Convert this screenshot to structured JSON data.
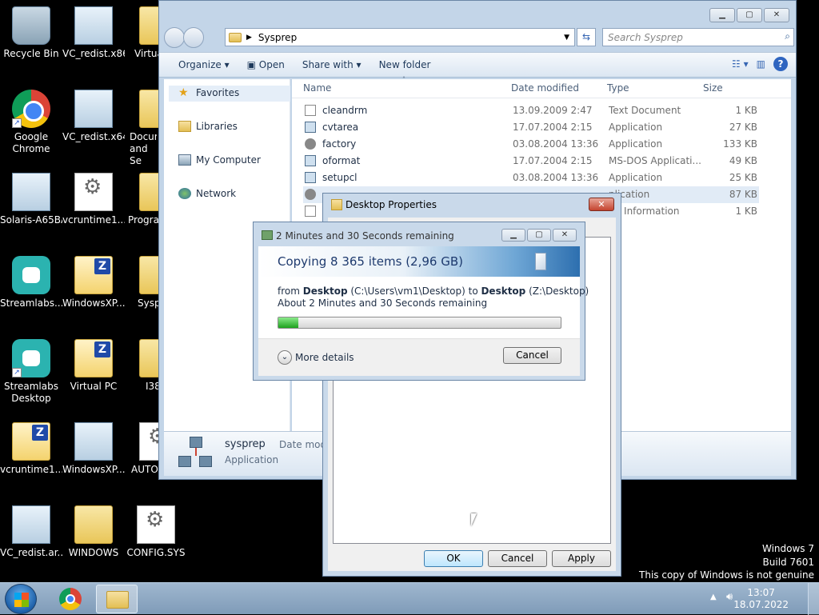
{
  "desktop": {
    "icons": [
      {
        "label": "Recycle Bin"
      },
      {
        "label": "VC_redist.x86"
      },
      {
        "label": "Virtua"
      },
      {
        "label": "Google Chrome"
      },
      {
        "label": "VC_redist.x64"
      },
      {
        "label": "Docur and Se"
      },
      {
        "label": "Solaris-A65BA"
      },
      {
        "label": "vcruntime1..."
      },
      {
        "label": "Progra"
      },
      {
        "label": "Streamlabs..."
      },
      {
        "label": "WindowsXP..."
      },
      {
        "label": "Sysp"
      },
      {
        "label": "Streamlabs Desktop"
      },
      {
        "label": "Virtual PC"
      },
      {
        "label": "I38"
      },
      {
        "label": "vcruntime1..."
      },
      {
        "label": "WindowsXP..."
      },
      {
        "label": "AUTO"
      },
      {
        "label": "VC_redist.ar..."
      },
      {
        "label": "WINDOWS"
      },
      {
        "label": "CONFIG.SYS"
      }
    ],
    "watermark": {
      "line1": "Windows 7",
      "line2": "Build 7601",
      "line3": "This copy of Windows is not genuine"
    }
  },
  "explorer": {
    "path": "Sysprep",
    "search_placeholder": "Search Sysprep",
    "toolbar": {
      "organize": "Organize",
      "open": "Open",
      "share": "Share with",
      "newfolder": "New folder"
    },
    "nav": {
      "favorites": "Favorites",
      "libraries": "Libraries",
      "computer": "My Computer",
      "network": "Network"
    },
    "columns": {
      "name": "Name",
      "date": "Date modified",
      "type": "Type",
      "size": "Size"
    },
    "rows": [
      {
        "name": "cleandrm",
        "date": "13.09.2009 2:47",
        "type": "Text Document",
        "size": "1 KB"
      },
      {
        "name": "cvtarea",
        "date": "17.07.2004 2:15",
        "type": "Application",
        "size": "27 KB"
      },
      {
        "name": "factory",
        "date": "03.08.2004 13:36",
        "type": "Application",
        "size": "133 KB"
      },
      {
        "name": "oformat",
        "date": "17.07.2004 2:15",
        "type": "MS-DOS Applicati...",
        "size": "49 KB"
      },
      {
        "name": "setupcl",
        "date": "03.08.2004 13:36",
        "type": "Application",
        "size": "25 KB"
      },
      {
        "name": "",
        "date": "",
        "type": "plication",
        "size": "87 KB"
      },
      {
        "name": "",
        "date": "",
        "type": "up Information",
        "size": "1 KB"
      }
    ],
    "detail": {
      "name": "sysprep",
      "type": "Application",
      "date_label": "Date mod"
    }
  },
  "props": {
    "title": "Desktop Properties",
    "ok": "OK",
    "cancel": "Cancel",
    "apply": "Apply"
  },
  "copy": {
    "title": "2 Minutes and 30 Seconds remaining",
    "headline": "Copying 8 365 items (2,96 GB)",
    "from_word": "from ",
    "from_name": "Desktop",
    "from_path": " (C:\\Users\\vm1\\Desktop) to ",
    "to_name": "Desktop",
    "to_path": " (Z:\\Desktop)",
    "remaining": "About 2 Minutes and 30 Seconds remaining",
    "progress_percent": 7,
    "more": "More details",
    "cancel": "Cancel"
  },
  "taskbar": {
    "time": "13:07",
    "date": "18.07.2022"
  }
}
